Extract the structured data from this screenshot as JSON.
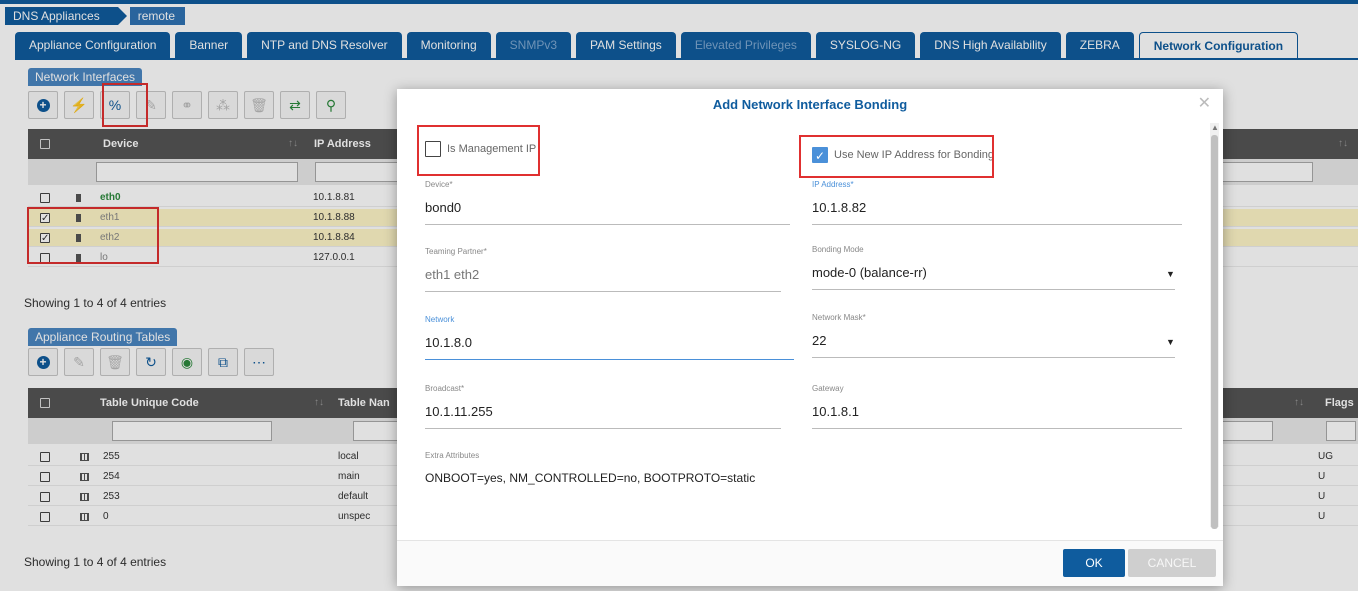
{
  "breadcrumb": {
    "root": "DNS Appliances",
    "current": "remote"
  },
  "tabs": [
    {
      "label": "Appliance Configuration",
      "state": "normal"
    },
    {
      "label": "Banner",
      "state": "normal"
    },
    {
      "label": "NTP and DNS Resolver",
      "state": "normal"
    },
    {
      "label": "Monitoring",
      "state": "normal"
    },
    {
      "label": "SNMPv3",
      "state": "disabled"
    },
    {
      "label": "PAM Settings",
      "state": "normal"
    },
    {
      "label": "Elevated Privileges",
      "state": "disabled"
    },
    {
      "label": "SYSLOG-NG",
      "state": "normal"
    },
    {
      "label": "DNS High Availability",
      "state": "normal"
    },
    {
      "label": "ZEBRA",
      "state": "normal"
    },
    {
      "label": "Network Configuration",
      "state": "active"
    }
  ],
  "network_interfaces": {
    "section_label": "Network Interfaces",
    "toolbar_icons": [
      "add-icon",
      "unlink-icon",
      "bond-link-icon",
      "edit-icon",
      "binoculars-icon",
      "network-icon",
      "trash-icon",
      "swap-icon",
      "search-icon"
    ],
    "columns": {
      "device": "Device",
      "ip": "IP Address"
    },
    "rows": [
      {
        "device": "eth0",
        "ip": "10.1.8.81",
        "checked": false,
        "highlight": false
      },
      {
        "device": "eth1",
        "ip": "10.1.8.88",
        "checked": true,
        "highlight": true
      },
      {
        "device": "eth2",
        "ip": "10.1.8.84",
        "checked": true,
        "highlight": true
      },
      {
        "device": "lo",
        "ip": "127.0.0.1",
        "checked": false,
        "highlight": false
      }
    ],
    "footer": "Showing 1 to 4 of 4 entries"
  },
  "routing_tables": {
    "section_label": "Appliance Routing Tables",
    "toolbar_icons": [
      "add-icon",
      "edit-icon",
      "trash-icon",
      "refresh-icon",
      "eye-slash-icon",
      "window-restore-icon",
      "more-icon"
    ],
    "columns": {
      "code": "Table Unique Code",
      "name": "Table Nan",
      "flags": "Flags"
    },
    "rows": [
      {
        "code": "255",
        "name": "local",
        "flags": "UG"
      },
      {
        "code": "254",
        "name": "main",
        "flags": "U"
      },
      {
        "code": "253",
        "name": "default",
        "flags": "U"
      },
      {
        "code": "0",
        "name": "unspec",
        "flags": "U"
      }
    ],
    "footer": "Showing 1 to 4 of 4 entries"
  },
  "modal": {
    "title": "Add Network Interface Bonding",
    "close_glyph": "✕",
    "is_management_ip": {
      "label": "Is Management IP",
      "checked": false
    },
    "use_new_ip": {
      "label": "Use New IP Address for Bonding",
      "checked": true
    },
    "device": {
      "label": "Device*",
      "value": "bond0"
    },
    "ip_address": {
      "label": "IP Address*",
      "value": "10.1.8.82"
    },
    "teaming_partner": {
      "label": "Teaming Partner*",
      "value": "eth1 eth2"
    },
    "bonding_mode": {
      "label": "Bonding Mode",
      "value": "mode-0 (balance-rr)"
    },
    "network": {
      "label": "Network",
      "value": "10.1.8.0"
    },
    "network_mask": {
      "label": "Network Mask*",
      "value": "22"
    },
    "broadcast": {
      "label": "Broadcast*",
      "value": "10.1.11.255"
    },
    "gateway": {
      "label": "Gateway",
      "value": "10.1.8.1"
    },
    "extra_attributes": {
      "label": "Extra Attributes",
      "value": "ONBOOT=yes, NM_CONTROLLED=no, BOOTPROTO=static"
    },
    "ok_label": "OK",
    "cancel_label": "CANCEL"
  },
  "colors": {
    "brand": "#0f5c9e",
    "selected_row": "#fff6c8",
    "highlight_box": "#e03030",
    "green": "#2d8a3e"
  }
}
